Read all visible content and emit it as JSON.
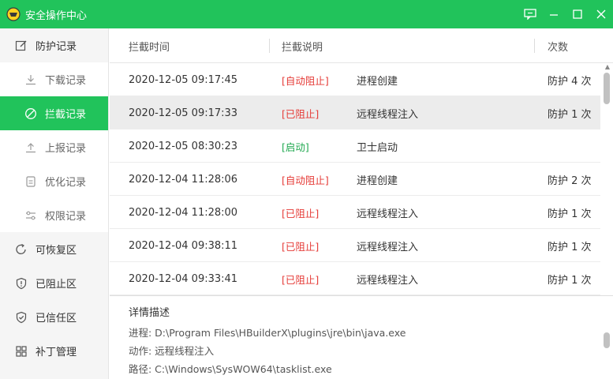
{
  "window": {
    "title": "安全操作中心",
    "accent": "#21c35b",
    "controls": [
      "feedback-icon",
      "minimize-icon",
      "maximize-icon",
      "close-icon"
    ]
  },
  "sidebar": {
    "items": [
      {
        "label": "防护记录",
        "icon": "edit-icon",
        "level": "top",
        "active": false
      },
      {
        "label": "下载记录",
        "icon": "download-icon",
        "level": "sub",
        "active": false
      },
      {
        "label": "拦截记录",
        "icon": "block-icon",
        "level": "sub",
        "active": true
      },
      {
        "label": "上报记录",
        "icon": "upload-icon",
        "level": "sub",
        "active": false
      },
      {
        "label": "优化记录",
        "icon": "document-icon",
        "level": "sub",
        "active": false
      },
      {
        "label": "权限记录",
        "icon": "sliders-icon",
        "level": "sub",
        "active": false
      },
      {
        "label": "可恢复区",
        "icon": "restore-icon",
        "level": "top",
        "active": false
      },
      {
        "label": "已阻止区",
        "icon": "shield-exclaim-icon",
        "level": "top",
        "active": false
      },
      {
        "label": "已信任区",
        "icon": "shield-check-icon",
        "level": "top",
        "active": false
      },
      {
        "label": "补丁管理",
        "icon": "grid-icon",
        "level": "top",
        "active": false
      }
    ]
  },
  "table": {
    "headers": {
      "time": "拦截时间",
      "desc": "拦截说明",
      "count": "次数"
    },
    "rows": [
      {
        "time": "2020-12-05 09:17:45",
        "action": "[自动阻止]",
        "action_color": "red",
        "desc": "进程创建",
        "count": "防护 4 次",
        "selected": false
      },
      {
        "time": "2020-12-05 09:17:33",
        "action": "[已阻止]",
        "action_color": "red",
        "desc": "远程线程注入",
        "count": "防护 1 次",
        "selected": true
      },
      {
        "time": "2020-12-05 08:30:23",
        "action": "[启动]",
        "action_color": "green",
        "desc": "卫士启动",
        "count": "",
        "selected": false
      },
      {
        "time": "2020-12-04 11:28:06",
        "action": "[自动阻止]",
        "action_color": "red",
        "desc": "进程创建",
        "count": "防护 2 次",
        "selected": false
      },
      {
        "time": "2020-12-04 11:28:00",
        "action": "[已阻止]",
        "action_color": "red",
        "desc": "远程线程注入",
        "count": "防护 1 次",
        "selected": false
      },
      {
        "time": "2020-12-04 09:38:11",
        "action": "[已阻止]",
        "action_color": "red",
        "desc": "远程线程注入",
        "count": "防护 1 次",
        "selected": false
      },
      {
        "time": "2020-12-04 09:33:41",
        "action": "[已阻止]",
        "action_color": "red",
        "desc": "远程线程注入",
        "count": "防护 1 次",
        "selected": false
      }
    ]
  },
  "detail": {
    "title": "详情描述",
    "lines": [
      "进程: D:\\Program Files\\HBuilderX\\plugins\\jre\\bin\\java.exe",
      "动作: 远程线程注入",
      "路径: C:\\Windows\\SysWOW64\\tasklist.exe"
    ]
  },
  "colors": {
    "red": "#e53935",
    "green": "#1fa84f",
    "selected_row": "#ececec"
  }
}
